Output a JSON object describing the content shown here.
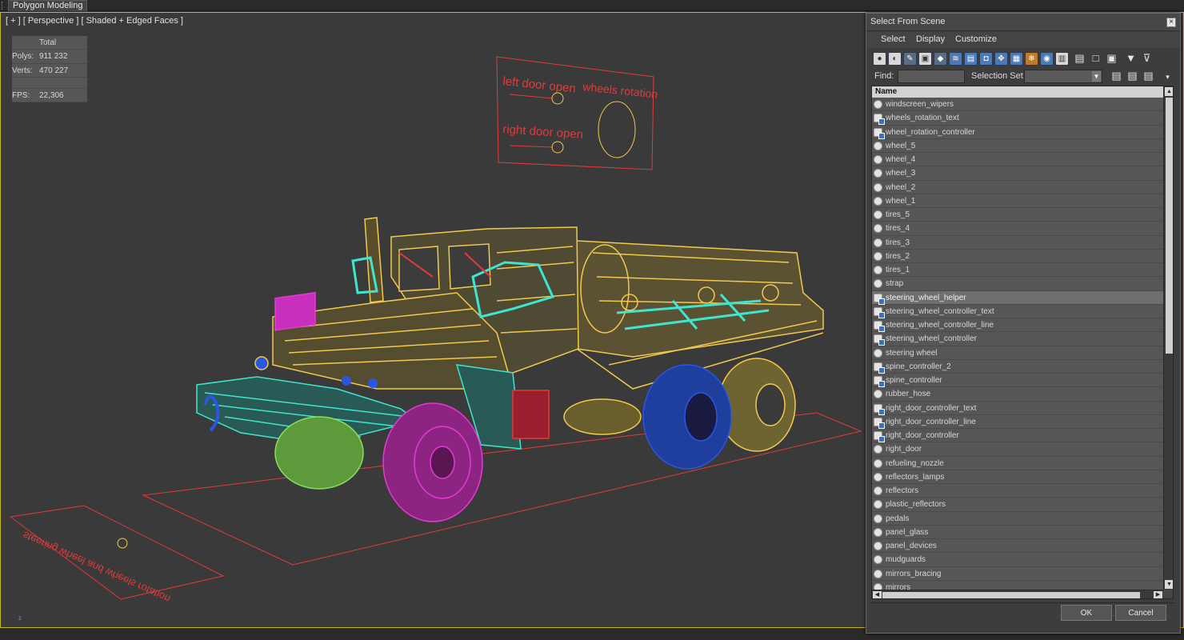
{
  "ribbon": {
    "tab_label": "Polygon Modeling"
  },
  "viewport": {
    "label": "[ + ] [ Perspective ] [ Shaded + Edged Faces ]",
    "stats": {
      "total_label": "Total",
      "polys_label": "Polys:",
      "polys_value": "911 232",
      "verts_label": "Verts:",
      "verts_value": "470 227",
      "fps_label": "FPS:",
      "fps_value": "22,306"
    },
    "axis_label": "z",
    "scene_labels": {
      "left_door_open": "left door open",
      "wheels_rotation": "wheels rotation",
      "right_door_open": "right door open",
      "floor_text": "steering wheel and wheels rotation"
    }
  },
  "dialog": {
    "title": "Select From Scene",
    "close_glyph": "×",
    "menu": {
      "select": "Select",
      "display": "Display",
      "customize": "Customize"
    },
    "find_label": "Find:",
    "find_value": "",
    "selection_set_label": "Selection Set:",
    "column_header": "Name",
    "items": [
      {
        "name": "windscreen_wipers",
        "type": "object"
      },
      {
        "name": "wheels_rotation_text",
        "type": "helper"
      },
      {
        "name": "wheel_rotation_controller",
        "type": "helper"
      },
      {
        "name": "wheel_5",
        "type": "object"
      },
      {
        "name": "wheel_4",
        "type": "object"
      },
      {
        "name": "wheel_3",
        "type": "object"
      },
      {
        "name": "wheel_2",
        "type": "object"
      },
      {
        "name": "wheel_1",
        "type": "object"
      },
      {
        "name": "tires_5",
        "type": "object"
      },
      {
        "name": "tires_4",
        "type": "object"
      },
      {
        "name": "tires_3",
        "type": "object"
      },
      {
        "name": "tires_2",
        "type": "object"
      },
      {
        "name": "tires_1",
        "type": "object"
      },
      {
        "name": "strap",
        "type": "object"
      },
      {
        "name": "steering_wheel_helper",
        "type": "helper",
        "selected": true
      },
      {
        "name": "steering_wheel_controller_text",
        "type": "helper"
      },
      {
        "name": "steering_wheel_controller_line",
        "type": "helper"
      },
      {
        "name": "steering_wheel_controller",
        "type": "helper"
      },
      {
        "name": "steering wheel",
        "type": "object"
      },
      {
        "name": "spine_controller_2",
        "type": "helper"
      },
      {
        "name": "spine_controller",
        "type": "helper"
      },
      {
        "name": "rubber_hose",
        "type": "object"
      },
      {
        "name": "right_door_controller_text",
        "type": "helper"
      },
      {
        "name": "right_door_controller_line",
        "type": "helper"
      },
      {
        "name": "right_door_controller",
        "type": "helper"
      },
      {
        "name": "right_door",
        "type": "object"
      },
      {
        "name": "refueling_nozzle",
        "type": "object"
      },
      {
        "name": "reflectors_lamps",
        "type": "object"
      },
      {
        "name": "reflectors",
        "type": "object"
      },
      {
        "name": "plastic_reflectors",
        "type": "object"
      },
      {
        "name": "pedals",
        "type": "object"
      },
      {
        "name": "panel_glass",
        "type": "object"
      },
      {
        "name": "panel_devices",
        "type": "object"
      },
      {
        "name": "mudguards",
        "type": "object"
      },
      {
        "name": "mirrors_bracing",
        "type": "object"
      },
      {
        "name": "mirrors",
        "type": "object"
      }
    ],
    "ok_label": "OK",
    "cancel_label": "Cancel"
  },
  "colors": {
    "viewport_border": "#c6b61e",
    "stats_text": "#e6d34a",
    "wire_yellow": "#f2c94c",
    "wire_cyan": "#3ee6d0",
    "wire_magenta": "#e23bd0",
    "wire_blue": "#2a56e0",
    "wire_green": "#8be05a",
    "controller_red": "#e23a3a"
  }
}
